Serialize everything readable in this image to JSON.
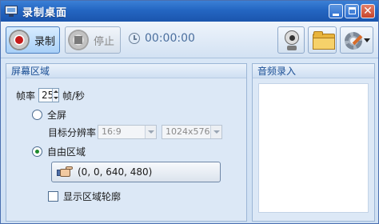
{
  "window": {
    "title": "录制桌面"
  },
  "titlebar_buttons": {
    "minimize_icon": "minimize-icon",
    "maximize_icon": "maximize-icon",
    "close_glyph": "✕"
  },
  "toolbar": {
    "record_label": "录制",
    "stop_label": "停止",
    "timer": "00:00:00",
    "icons": [
      "record-icon",
      "stop-icon",
      "clock-icon",
      "webcam-icon",
      "folder-icon",
      "settings-icon"
    ]
  },
  "screen_area": {
    "header": "屏幕区域",
    "fps_label": "帧率",
    "fps_value": "25",
    "fps_unit": "帧/秒",
    "fullscreen_label": "全屏",
    "fullscreen_selected": false,
    "target_resolution_label": "目标分辨率",
    "aspect_ratio_value": "16:9",
    "resolution_value": "1024x576",
    "custom_region_label": "自由区域",
    "custom_region_selected": true,
    "region_value": "(0, 0, 640, 480)",
    "show_outline_label": "显示区域轮廓",
    "show_outline_checked": false
  },
  "audio": {
    "header": "音频录入"
  }
}
